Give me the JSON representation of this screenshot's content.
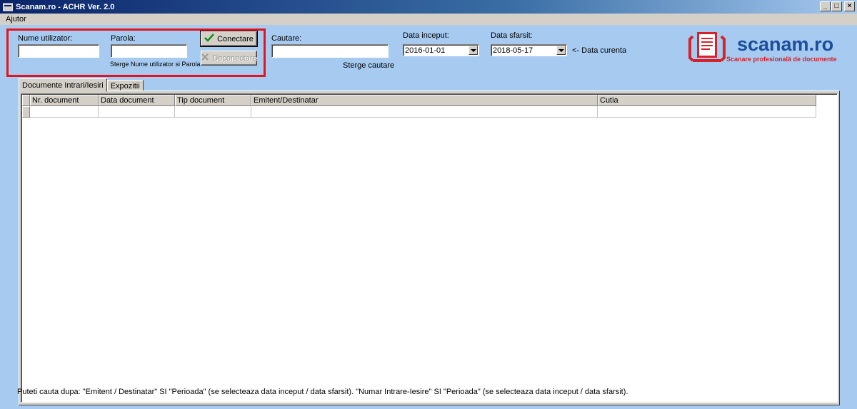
{
  "window": {
    "title": "Scanam.ro - ACHR Ver. 2.0",
    "minimize": "_",
    "maximize": "□",
    "close": "×"
  },
  "menu": {
    "items": [
      {
        "label": "Ajutor"
      }
    ]
  },
  "login": {
    "username_label": "Nume utilizator:",
    "username_value": "",
    "password_label": "Parola:",
    "password_value": "",
    "clear_hint": "Sterge Nume utilizator si Parola",
    "connect_label": "Conectare",
    "disconnect_label": "Deconectare"
  },
  "search": {
    "label": "Cautare:",
    "value": "",
    "clear_hint": "Sterge cautare"
  },
  "dates": {
    "start_label": "Data inceput:",
    "start_value": "2016-01-01",
    "end_label": "Data sfarsit:",
    "end_value": "2018-05-17",
    "current_hint": "<- Data curenta"
  },
  "logo": {
    "title": "scanam.ro",
    "subtitle": "Scanare profesională de documente",
    "colors": {
      "blue": "#1b4f9c",
      "red": "#d6232a"
    }
  },
  "tabs": [
    {
      "label": "Documente Intrari/Iesiri",
      "active": true
    },
    {
      "label": "Expozitii",
      "active": false
    }
  ],
  "grid": {
    "columns": [
      "Nr. document",
      "Data document",
      "Tip document",
      "Emitent/Destinatar",
      "Cutia"
    ]
  },
  "footer": {
    "text": "Puteti cauta dupa:  \"Emitent / Destinatar\" SI \"Perioada\" (se selecteaza data inceput / data sfarsit).     \"Numar Intrare-Iesire\" SI \"Perioada\" (se selecteaza data inceput / data sfarsit)."
  }
}
